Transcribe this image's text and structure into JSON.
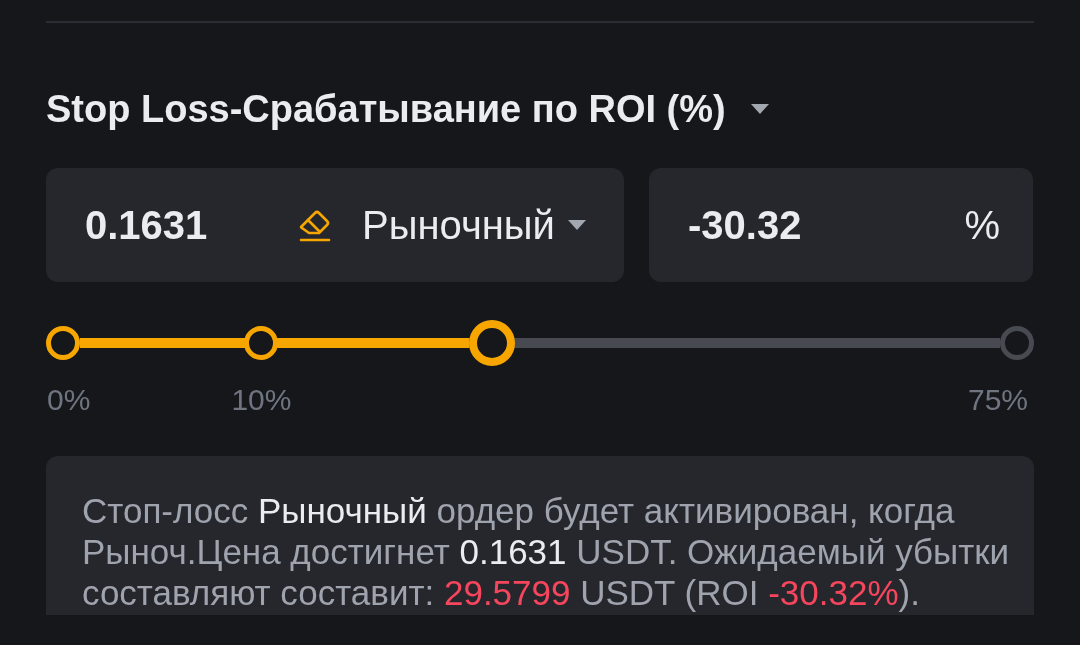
{
  "section": {
    "title": "Stop Loss-Срабатывание по ROI (%)"
  },
  "price_field": {
    "value": "0.1631",
    "order_type": "Рыночный"
  },
  "roi_field": {
    "value": "-30.32",
    "unit": "%"
  },
  "slider": {
    "level": 0.45,
    "marks": [
      {
        "label": "0%"
      },
      {
        "label": "10%"
      },
      {
        "label": "75%"
      }
    ]
  },
  "summary": {
    "segments": [
      {
        "kind": "plain",
        "text": "Стоп-лосс "
      },
      {
        "kind": "emphasis",
        "text": "Рыночный"
      },
      {
        "kind": "plain",
        "text": " ордер будет активирован, когда Рыноч.Цена достигнет "
      },
      {
        "kind": "emphasis",
        "text": "0.1631"
      },
      {
        "kind": "plain",
        "text": " USDT. Ожидаемый убытки составляют составит: "
      },
      {
        "kind": "loss",
        "text": "29.5799"
      },
      {
        "kind": "plain",
        "text": " USDT (ROI "
      },
      {
        "kind": "loss",
        "text": "-30.32%"
      },
      {
        "kind": "plain",
        "text": ")."
      }
    ]
  }
}
